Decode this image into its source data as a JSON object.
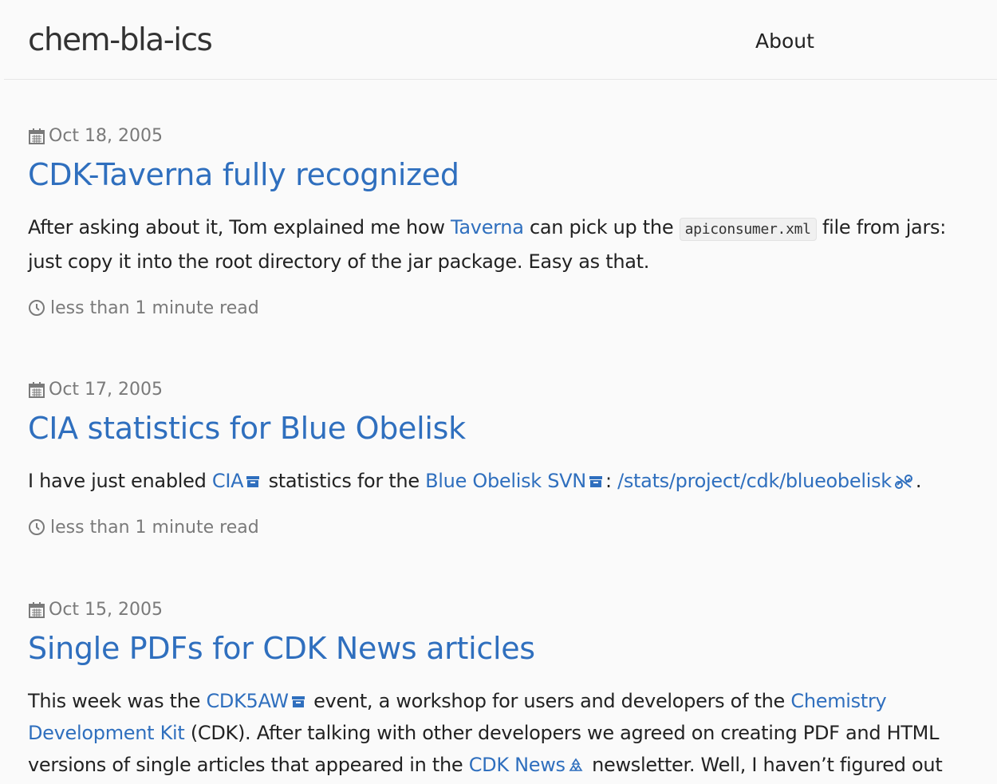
{
  "header": {
    "site_title": "chem-bla-ics",
    "nav_about": "About"
  },
  "posts": [
    {
      "date": "Oct 18, 2005",
      "title": "CDK-Taverna fully recognized",
      "excerpt": {
        "t1": "After asking about it, Tom explained me how ",
        "link_taverna": "Taverna",
        "t2": " can pick up the ",
        "code": "apiconsumer.xml",
        "t3": " file from jars: just copy it into the root directory of the jar package. Easy as that."
      },
      "read_time": "less than 1 minute read"
    },
    {
      "date": "Oct 17, 2005",
      "title": "CIA statistics for Blue Obelisk",
      "excerpt": {
        "t1": "I have just enabled ",
        "link_cia": "CIA",
        "t2": " statistics for the ",
        "link_svn": "Blue Obelisk SVN",
        "t3": ": ",
        "link_stats": "/stats/project/cdk/blueobelisk",
        "t4": "."
      },
      "read_time": "less than 1 minute read"
    },
    {
      "date": "Oct 15, 2005",
      "title": "Single PDFs for CDK News articles",
      "excerpt": {
        "t1": "This week was the ",
        "link_cdk5aw": "CDK5AW",
        "t2": " event, a workshop for users and developers of the ",
        "link_cdk": "Chemistry Development Kit",
        "t3": " (CDK). After talking with other developers we agreed on creating PDF and HTML versions of single articles that appeared in the ",
        "link_news": "CDK News",
        "t4": " newsletter. Well, I haven’t figured out"
      }
    }
  ],
  "colors": {
    "link": "#2f6fbe",
    "meta": "#7a7a7a",
    "text": "#222222"
  }
}
